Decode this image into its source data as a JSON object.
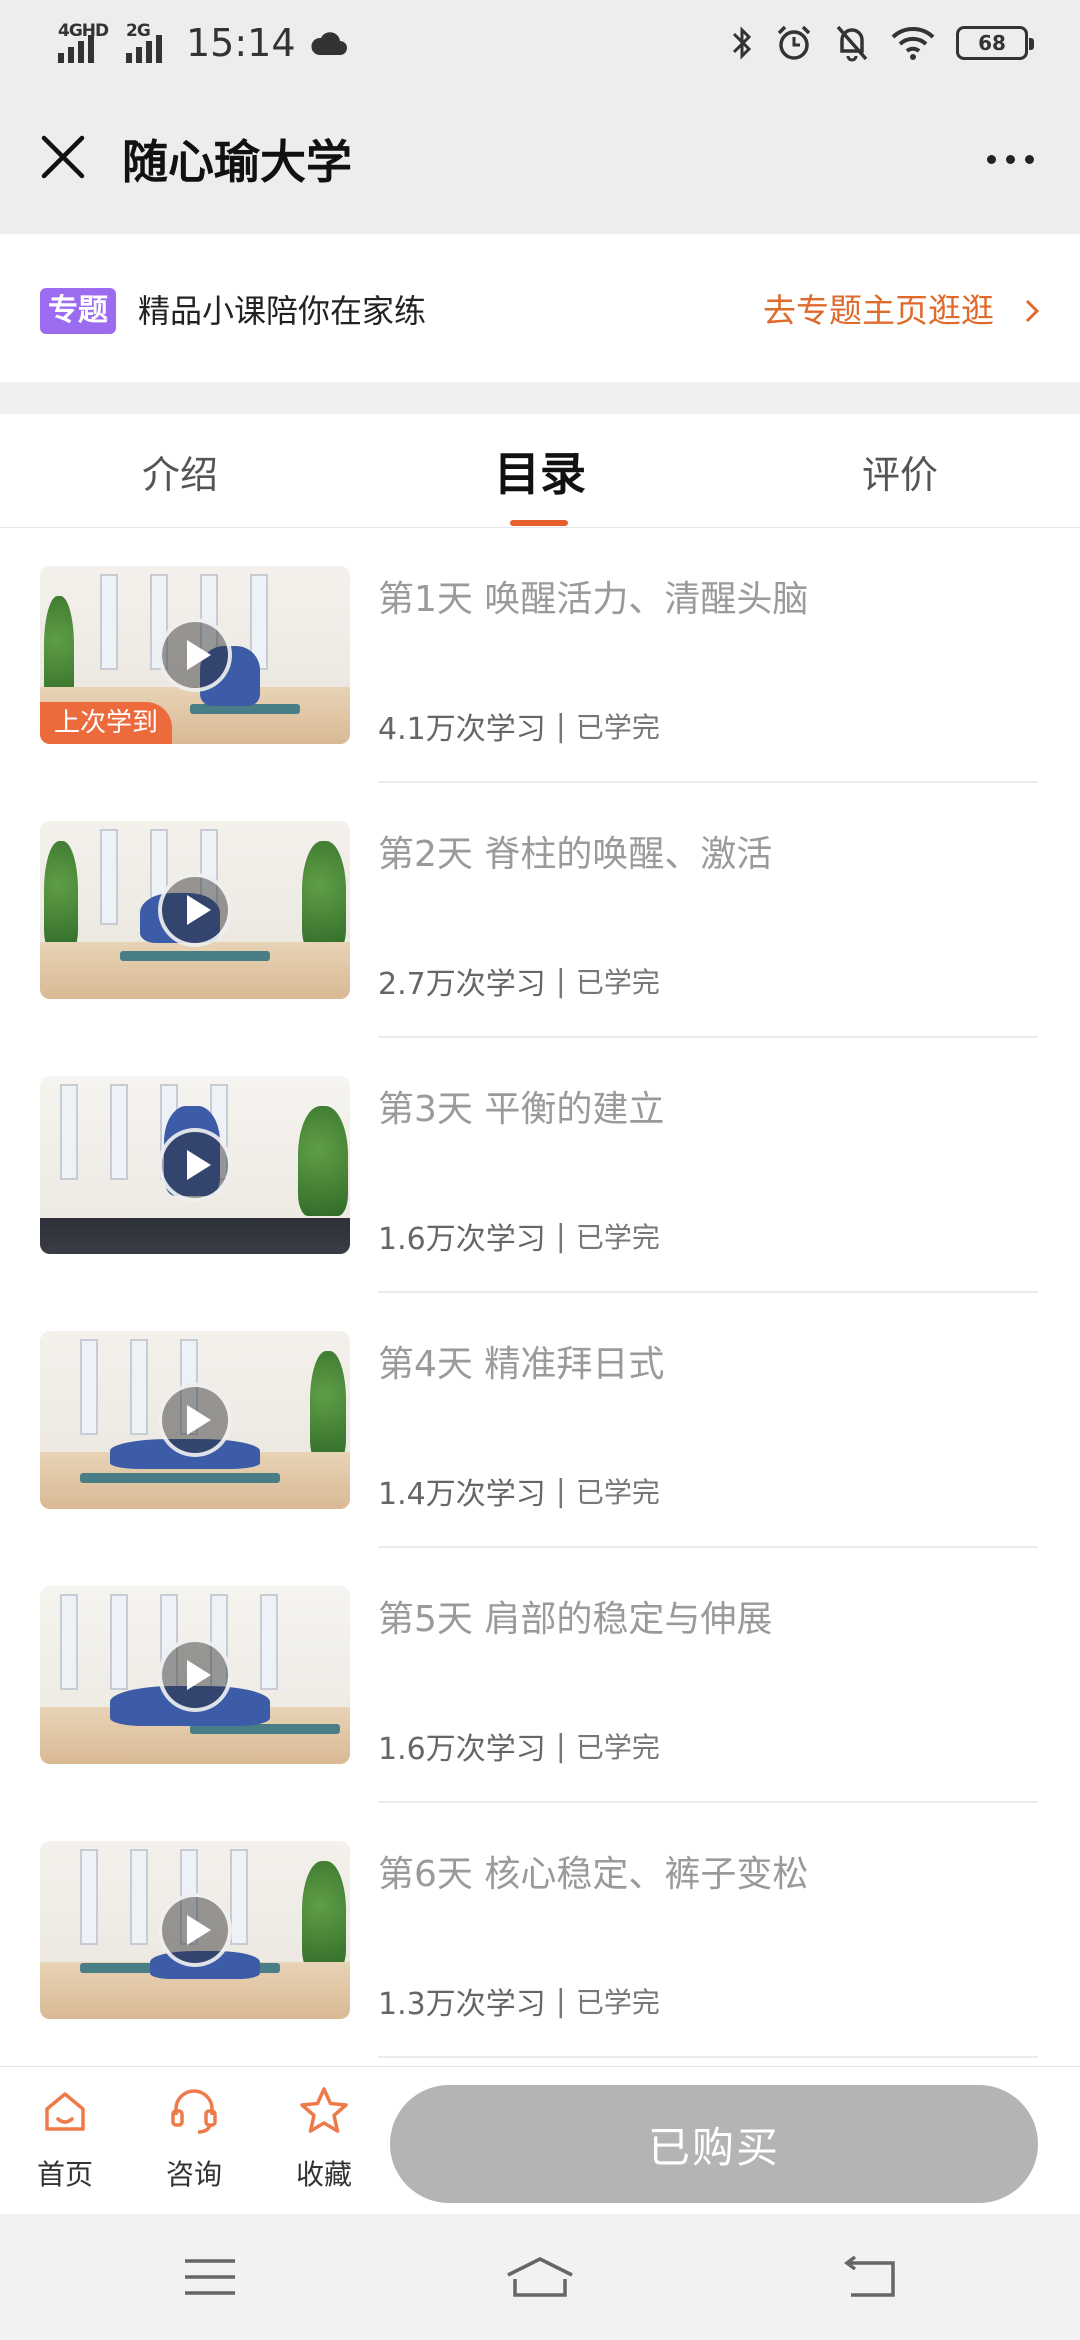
{
  "status_bar": {
    "signal1_label": "4GHD",
    "signal2_label": "2G",
    "time": "15:14",
    "battery": "68"
  },
  "header": {
    "title": "随心瑜大学"
  },
  "banner": {
    "badge": "专题",
    "text": "精品小课陪你在家练",
    "link_label": "去专题主页逛逛",
    "link_color": "#e06a2c",
    "badge_color": "#9b6cf0"
  },
  "tabs": [
    {
      "label": "介绍",
      "active": false
    },
    {
      "label": "目录",
      "active": true
    },
    {
      "label": "评价",
      "active": false
    }
  ],
  "accent_color": "#e8602c",
  "lessons": [
    {
      "title": "第1天 唤醒活力、清醒头脑",
      "views": "4.1万次学习",
      "sep": "|",
      "status": "已学完",
      "tag": "上次学到"
    },
    {
      "title": "第2天 脊柱的唤醒、激活",
      "views": "2.7万次学习",
      "sep": "|",
      "status": "已学完",
      "tag": ""
    },
    {
      "title": "第3天 平衡的建立",
      "views": "1.6万次学习",
      "sep": "|",
      "status": "已学完",
      "tag": ""
    },
    {
      "title": "第4天 精准拜日式",
      "views": "1.4万次学习",
      "sep": "|",
      "status": "已学完",
      "tag": ""
    },
    {
      "title": "第5天 肩部的稳定与伸展",
      "views": "1.6万次学习",
      "sep": "|",
      "status": "已学完",
      "tag": ""
    },
    {
      "title": "第6天 核心稳定、裤子变松",
      "views": "1.3万次学习",
      "sep": "|",
      "status": "已学完",
      "tag": ""
    }
  ],
  "action_bar": {
    "home_label": "首页",
    "consult_label": "咨询",
    "favorite_label": "收藏",
    "buy_label": "已购买"
  }
}
